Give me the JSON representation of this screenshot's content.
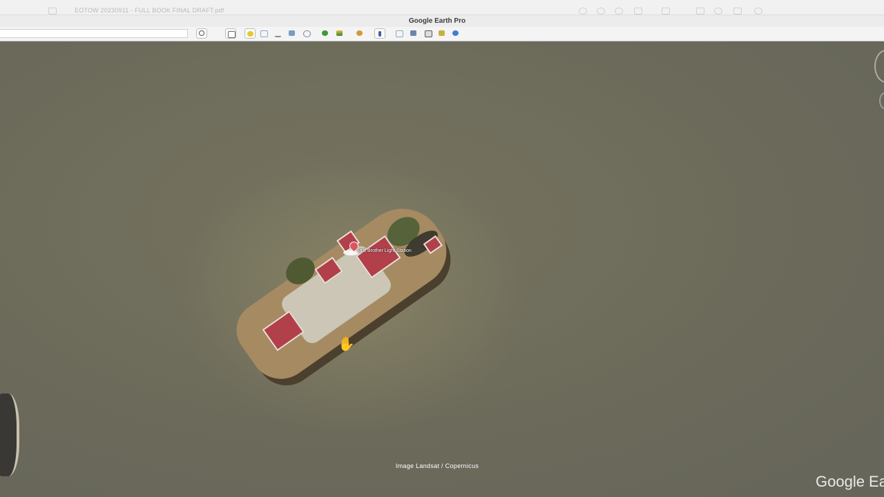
{
  "background_window": {
    "title": "EOTOW 20230911 - FULL BOOK FINAL DRAFT.pdf"
  },
  "window": {
    "title": "Google Earth Pro"
  },
  "toolbar": {
    "search_placeholder": "",
    "buttons": [
      {
        "name": "search-icon"
      },
      {
        "name": "sidebar-toggle-icon"
      },
      {
        "name": "placemark-icon"
      },
      {
        "name": "polygon-icon"
      },
      {
        "name": "path-icon"
      },
      {
        "name": "image-overlay-icon"
      },
      {
        "name": "record-tour-icon"
      },
      {
        "name": "historical-imagery-icon"
      },
      {
        "name": "sunlight-icon"
      },
      {
        "name": "planets-icon"
      },
      {
        "name": "ruler-icon"
      },
      {
        "name": "email-icon"
      },
      {
        "name": "print-icon"
      },
      {
        "name": "save-image-icon"
      },
      {
        "name": "view-in-maps-icon"
      },
      {
        "name": "globe-icon"
      }
    ]
  },
  "map": {
    "place_label": "East Brother Light Station",
    "attribution": "Image Landsat / Copernicus",
    "watermark": "Google Ea",
    "cursor": "hand-cursor-icon"
  },
  "colors": {
    "water": "#6e6c60",
    "roofs": "#b2404a",
    "pin": "#d8585e",
    "cursor": "#e8563a"
  }
}
